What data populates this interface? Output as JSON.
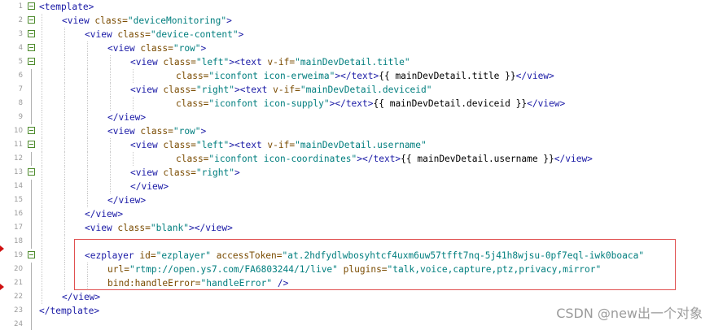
{
  "editor": {
    "lines": [
      {
        "num": "1",
        "indent": 0,
        "fold": true,
        "tokens": [
          [
            "tag",
            "<template>"
          ]
        ]
      },
      {
        "num": "2",
        "indent": 1,
        "fold": true,
        "tokens": [
          [
            "tag",
            "<view "
          ],
          [
            "attr",
            "class="
          ],
          [
            "val",
            "\"deviceMonitoring\""
          ],
          [
            "tag",
            ">"
          ]
        ]
      },
      {
        "num": "3",
        "indent": 2,
        "fold": true,
        "tokens": [
          [
            "tag",
            "<view "
          ],
          [
            "attr",
            "class="
          ],
          [
            "val",
            "\"device-content\""
          ],
          [
            "tag",
            ">"
          ]
        ]
      },
      {
        "num": "4",
        "indent": 3,
        "fold": true,
        "tokens": [
          [
            "tag",
            "<view "
          ],
          [
            "attr",
            "class="
          ],
          [
            "val",
            "\"row\""
          ],
          [
            "tag",
            ">"
          ]
        ]
      },
      {
        "num": "5",
        "indent": 4,
        "fold": true,
        "tokens": [
          [
            "tag",
            "<view "
          ],
          [
            "attr",
            "class="
          ],
          [
            "val",
            "\"left\""
          ],
          [
            "tag",
            "><text "
          ],
          [
            "attr",
            "v-if="
          ],
          [
            "val",
            "\"mainDevDetail.title\""
          ]
        ]
      },
      {
        "num": "6",
        "indent": 6,
        "fold": false,
        "tokens": [
          [
            "attr",
            "class="
          ],
          [
            "val",
            "\"iconfont icon-erweima\""
          ],
          [
            "tag",
            "></text>"
          ],
          [
            "text",
            "{{ mainDevDetail.title }}"
          ],
          [
            "tag",
            "</view>"
          ]
        ]
      },
      {
        "num": "7",
        "indent": 4,
        "fold": false,
        "tokens": [
          [
            "tag",
            "<view "
          ],
          [
            "attr",
            "class="
          ],
          [
            "val",
            "\"right\""
          ],
          [
            "tag",
            "><text "
          ],
          [
            "attr",
            "v-if="
          ],
          [
            "val",
            "\"mainDevDetail.deviceid\""
          ]
        ]
      },
      {
        "num": "8",
        "indent": 6,
        "fold": false,
        "tokens": [
          [
            "attr",
            "class="
          ],
          [
            "val",
            "\"iconfont icon-supply\""
          ],
          [
            "tag",
            "></text>"
          ],
          [
            "text",
            "{{ mainDevDetail.deviceid }}"
          ],
          [
            "tag",
            "</view>"
          ]
        ]
      },
      {
        "num": "9",
        "indent": 3,
        "fold": false,
        "tokens": [
          [
            "tag",
            "</view>"
          ]
        ]
      },
      {
        "num": "10",
        "indent": 3,
        "fold": true,
        "tokens": [
          [
            "tag",
            "<view "
          ],
          [
            "attr",
            "class="
          ],
          [
            "val",
            "\"row\""
          ],
          [
            "tag",
            ">"
          ]
        ]
      },
      {
        "num": "11",
        "indent": 4,
        "fold": true,
        "tokens": [
          [
            "tag",
            "<view "
          ],
          [
            "attr",
            "class="
          ],
          [
            "val",
            "\"left\""
          ],
          [
            "tag",
            "><text "
          ],
          [
            "attr",
            "v-if="
          ],
          [
            "val",
            "\"mainDevDetail.username\""
          ]
        ]
      },
      {
        "num": "12",
        "indent": 6,
        "fold": false,
        "tokens": [
          [
            "attr",
            "class="
          ],
          [
            "val",
            "\"iconfont icon-coordinates\""
          ],
          [
            "tag",
            "></text>"
          ],
          [
            "text",
            "{{ mainDevDetail.username }}"
          ],
          [
            "tag",
            "</view>"
          ]
        ]
      },
      {
        "num": "13",
        "indent": 4,
        "fold": true,
        "tokens": [
          [
            "tag",
            "<view "
          ],
          [
            "attr",
            "class="
          ],
          [
            "val",
            "\"right\""
          ],
          [
            "tag",
            ">"
          ]
        ]
      },
      {
        "num": "14",
        "indent": 4,
        "fold": false,
        "tokens": [
          [
            "tag",
            "</view>"
          ]
        ]
      },
      {
        "num": "15",
        "indent": 3,
        "fold": false,
        "tokens": [
          [
            "tag",
            "</view>"
          ]
        ]
      },
      {
        "num": "16",
        "indent": 2,
        "fold": false,
        "tokens": [
          [
            "tag",
            "</view>"
          ]
        ]
      },
      {
        "num": "17",
        "indent": 2,
        "fold": false,
        "tokens": [
          [
            "tag",
            "<view "
          ],
          [
            "attr",
            "class="
          ],
          [
            "val",
            "\"blank\""
          ],
          [
            "tag",
            "></view>"
          ]
        ]
      },
      {
        "num": "18",
        "indent": 2,
        "fold": false,
        "tokens": []
      },
      {
        "num": "19",
        "indent": 2,
        "fold": true,
        "tokens": [
          [
            "tag",
            "<ezplayer "
          ],
          [
            "attr",
            "id="
          ],
          [
            "val",
            "\"ezplayer\""
          ],
          [
            "text",
            " "
          ],
          [
            "attr",
            "accessToken="
          ],
          [
            "val",
            "\"at.2hdfydlwbosyhtcf4uxm6uw57tfft7nq-5j41h8wjsu-0pf7eql-iwk0boaca\""
          ]
        ]
      },
      {
        "num": "20",
        "indent": 3,
        "fold": false,
        "tokens": [
          [
            "attr",
            "url="
          ],
          [
            "val",
            "\"rtmp://open.ys7.com/FA6803244/1/live\""
          ],
          [
            "text",
            " "
          ],
          [
            "attr",
            "plugins="
          ],
          [
            "val",
            "\"talk,voice,capture,ptz,privacy,mirror\""
          ]
        ]
      },
      {
        "num": "21",
        "indent": 3,
        "fold": false,
        "tokens": [
          [
            "attr",
            "bind:handleError="
          ],
          [
            "val",
            "\"handleError\""
          ],
          [
            "text",
            " "
          ],
          [
            "tag",
            "/>"
          ]
        ]
      },
      {
        "num": "22",
        "indent": 1,
        "fold": false,
        "tokens": [
          [
            "tag",
            "</view>"
          ]
        ]
      },
      {
        "num": "23",
        "indent": 0,
        "fold": false,
        "tokens": [
          [
            "tag",
            "</template>"
          ]
        ]
      },
      {
        "num": "24",
        "indent": 0,
        "fold": false,
        "tokens": []
      }
    ],
    "token_colors": {
      "tag": "#1a1aa6",
      "attr": "#7a4b00",
      "val": "#007e7e",
      "text": "#000000"
    },
    "highlight_color": "#e05050"
  },
  "watermark": {
    "text": "CSDN @new出一个对象"
  }
}
